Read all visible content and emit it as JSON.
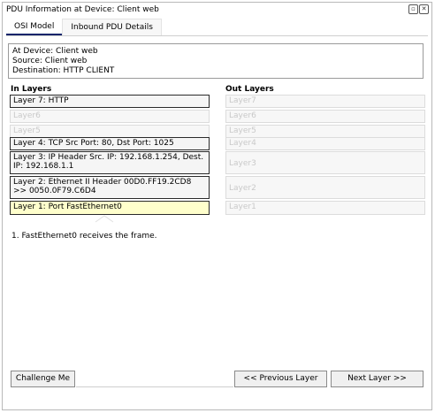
{
  "window": {
    "title": "PDU Information at Device: Client web",
    "restore_icon": "restore-icon",
    "close_icon": "close-icon"
  },
  "tabs": [
    {
      "label": "OSI Model",
      "active": true
    },
    {
      "label": "Inbound PDU Details",
      "active": false
    }
  ],
  "info": {
    "line1": "At Device: Client web",
    "line2": "Source: Client web",
    "line3": "Destination: HTTP CLIENT"
  },
  "in_layers": {
    "heading": "In Layers",
    "items": [
      {
        "label": "Layer 7: HTTP",
        "state": "active"
      },
      {
        "label": "Layer6",
        "state": "disabled"
      },
      {
        "label": "Layer5",
        "state": "disabled"
      },
      {
        "label": "Layer 4: TCP Src Port: 80, Dst Port: 1025",
        "state": "active"
      },
      {
        "label": "Layer 3: IP Header Src. IP: 192.168.1.254, Dest. IP: 192.168.1.1",
        "state": "active"
      },
      {
        "label": "Layer 2: Ethernet II Header 00D0.FF19.2CD8 >> 0050.0F79.C6D4",
        "state": "active"
      },
      {
        "label": "Layer 1: Port FastEthernet0",
        "state": "selected"
      }
    ]
  },
  "out_layers": {
    "heading": "Out Layers",
    "items": [
      {
        "label": "Layer7"
      },
      {
        "label": "Layer6"
      },
      {
        "label": "Layer5"
      },
      {
        "label": "Layer4"
      },
      {
        "label": "Layer3"
      },
      {
        "label": "Layer2"
      },
      {
        "label": "Layer1"
      }
    ]
  },
  "description": "1. FastEthernet0 receives the frame.",
  "buttons": {
    "challenge": "Challenge Me",
    "previous": "<< Previous Layer",
    "next": "Next Layer >>"
  }
}
